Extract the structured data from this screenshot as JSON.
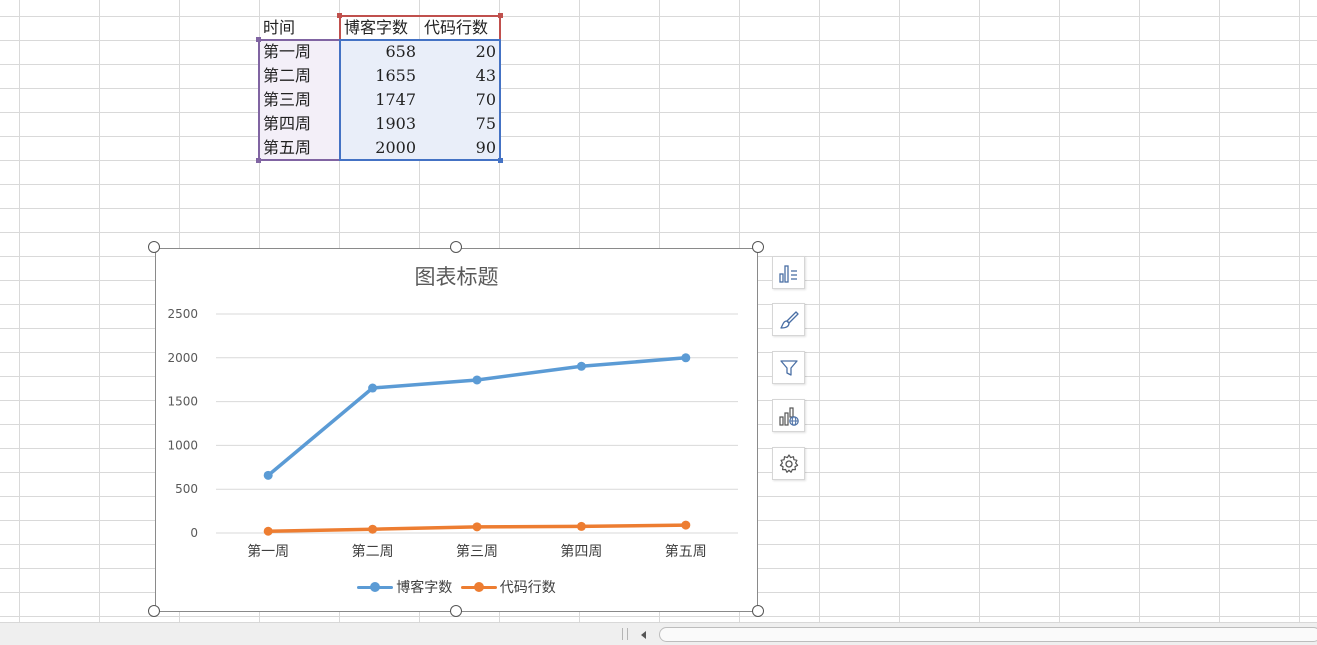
{
  "sheet": {
    "header": {
      "time": "时间",
      "blog_chars": "博客字数",
      "code_lines": "代码行数"
    },
    "rows": [
      {
        "week": "第一周",
        "blog_chars": "658",
        "code_lines": "20"
      },
      {
        "week": "第二周",
        "blog_chars": "1655",
        "code_lines": "43"
      },
      {
        "week": "第三周",
        "blog_chars": "1747",
        "code_lines": "70"
      },
      {
        "week": "第四周",
        "blog_chars": "1903",
        "code_lines": "75"
      },
      {
        "week": "第五周",
        "blog_chars": "2000",
        "code_lines": "90"
      }
    ]
  },
  "chart": {
    "title": "图表标题"
  },
  "chart_data": {
    "type": "line",
    "title": "图表标题",
    "categories": [
      "第一周",
      "第二周",
      "第三周",
      "第四周",
      "第五周"
    ],
    "series": [
      {
        "name": "博客字数",
        "values": [
          658,
          1655,
          1747,
          1903,
          2000
        ],
        "color": "#5b9bd5"
      },
      {
        "name": "代码行数",
        "values": [
          20,
          43,
          70,
          75,
          90
        ],
        "color": "#ed7d31"
      }
    ],
    "yticks": [
      "0",
      "500",
      "1000",
      "1500",
      "2000",
      "2500"
    ],
    "ylim": [
      0,
      2500
    ],
    "grid": true,
    "legend": "bottom"
  },
  "colors": {
    "grid_line": "#d9d9d9",
    "range_header": "#c0504d",
    "range_label": "#8064a2",
    "range_values": "#4472c4",
    "label_fill": "#f3eff8",
    "values_fill": "#e9eef9"
  },
  "side_tools": [
    {
      "name": "chart-elements-button",
      "icon": "chart-elements-icon"
    },
    {
      "name": "chart-styles-button",
      "icon": "brush-icon"
    },
    {
      "name": "chart-filter-button",
      "icon": "filter-icon"
    },
    {
      "name": "online-chart-button",
      "icon": "chart-globe-icon"
    },
    {
      "name": "chart-settings-button",
      "icon": "gear-icon"
    }
  ]
}
